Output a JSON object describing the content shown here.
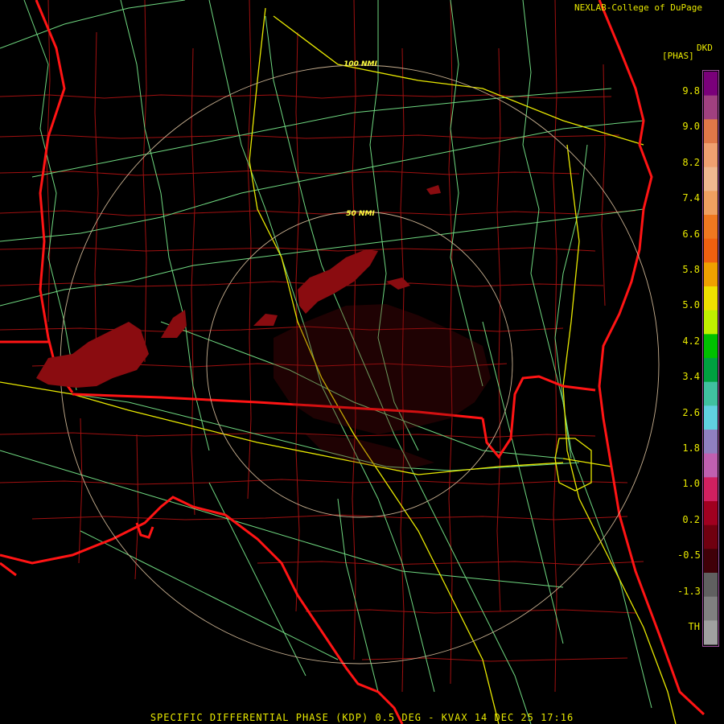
{
  "credit": "NEXLAB-College of DuPage",
  "units_line1": "DKD",
  "units_line2": "[PHAS]",
  "title": "SPECIFIC DIFFERENTIAL PHASE (KDP) 0.5 DEG - KVAX 14 DEC 25 17:16",
  "range_rings": [
    "100 NMI",
    "50 NMI"
  ],
  "color_scale": {
    "labels": [
      "9.8",
      "9.0",
      "8.2",
      "7.4",
      "6.6",
      "5.8",
      "5.0",
      "4.2",
      "3.4",
      "2.6",
      "1.8",
      "1.0",
      "0.2",
      "-0.5",
      "-1.3",
      "TH"
    ],
    "colors": [
      "#7a007a",
      "#a04080",
      "#e07848",
      "#f0a070",
      "#f0b890",
      "#f0a060",
      "#f07820",
      "#f06010",
      "#f0a000",
      "#f0e000",
      "#c0f000",
      "#00c000",
      "#00a040",
      "#40c0a0",
      "#60d0e0",
      "#9080c0",
      "#c060b0",
      "#d02060",
      "#a00020",
      "#700010",
      "#400008",
      "#606060",
      "#808080",
      "#a0a0a0"
    ]
  },
  "colors": {
    "state_border": "#ff1010",
    "county_lines": "#b01010",
    "highways": "#70e080",
    "interstates": "#e8e800",
    "range_ring": "#c8b090",
    "echo": "#8a0c10"
  }
}
